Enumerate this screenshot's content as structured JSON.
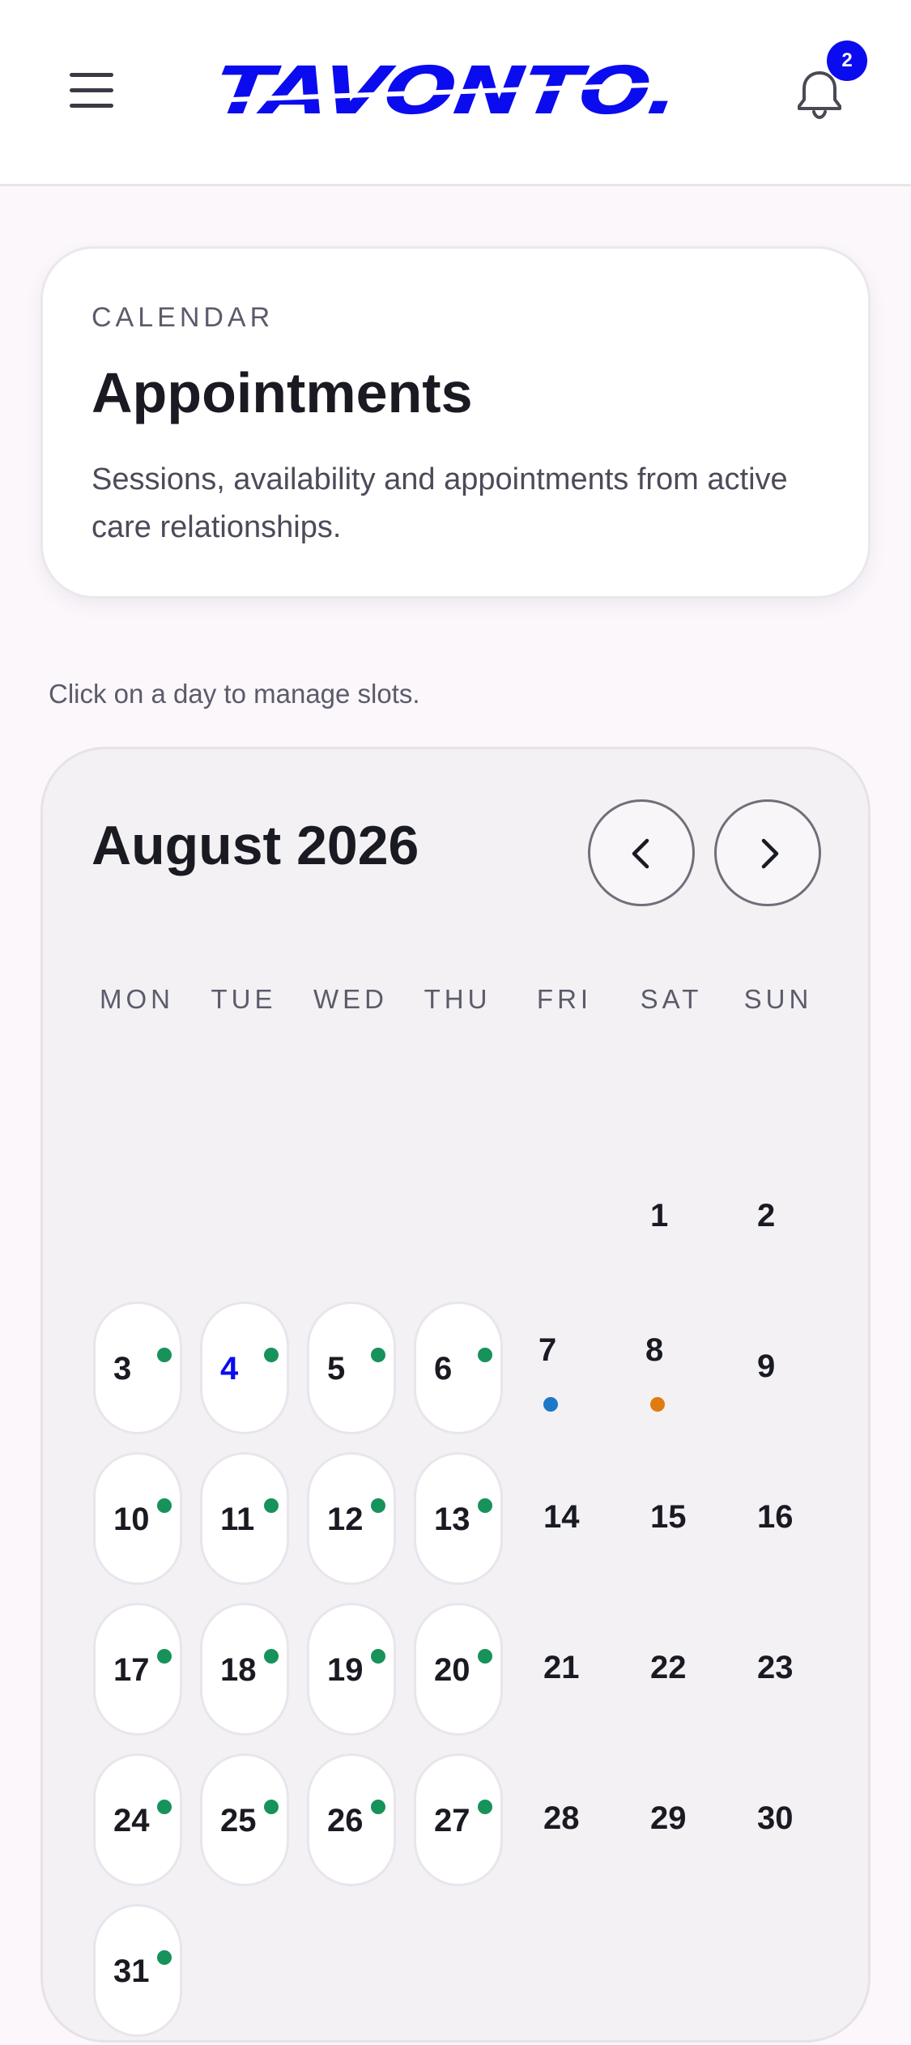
{
  "header": {
    "brand": "TAVONTO.",
    "notification_count": "2"
  },
  "intro": {
    "eyebrow": "CALENDAR",
    "title": "Appointments",
    "description": "Sessions, availability and appointments from active care relationships."
  },
  "hint": "Click on a day to manage slots.",
  "calendar": {
    "month_label": "August 2026",
    "weekdays": [
      "MON",
      "TUE",
      "WED",
      "THU",
      "FRI",
      "SAT",
      "SUN"
    ],
    "days": [
      {
        "num": "1"
      },
      {
        "num": "2"
      },
      {
        "num": "3",
        "slots": true
      },
      {
        "num": "4",
        "slots": true,
        "today": true
      },
      {
        "num": "5",
        "slots": true
      },
      {
        "num": "6",
        "slots": true
      },
      {
        "num": "7",
        "marker": "blue"
      },
      {
        "num": "8",
        "marker": "orange"
      },
      {
        "num": "9"
      },
      {
        "num": "10",
        "slots": true
      },
      {
        "num": "11",
        "slots": true
      },
      {
        "num": "12",
        "slots": true
      },
      {
        "num": "13",
        "slots": true
      },
      {
        "num": "14"
      },
      {
        "num": "15"
      },
      {
        "num": "16"
      },
      {
        "num": "17",
        "slots": true
      },
      {
        "num": "18",
        "slots": true
      },
      {
        "num": "19",
        "slots": true
      },
      {
        "num": "20",
        "slots": true
      },
      {
        "num": "21"
      },
      {
        "num": "22"
      },
      {
        "num": "23"
      },
      {
        "num": "24",
        "slots": true
      },
      {
        "num": "25",
        "slots": true
      },
      {
        "num": "26",
        "slots": true
      },
      {
        "num": "27",
        "slots": true
      },
      {
        "num": "28"
      },
      {
        "num": "29"
      },
      {
        "num": "30"
      },
      {
        "num": "31",
        "slots": true
      }
    ],
    "first_weekday_index": 5
  },
  "colors": {
    "accent": "#0b0bef",
    "available_dot": "#17925a",
    "blue_dot": "#1d78c8",
    "orange_dot": "#e07b12"
  },
  "icons": {
    "menu": "hamburger-menu-icon",
    "bell": "bell-icon",
    "prev": "chevron-left-icon",
    "next": "chevron-right-icon"
  }
}
